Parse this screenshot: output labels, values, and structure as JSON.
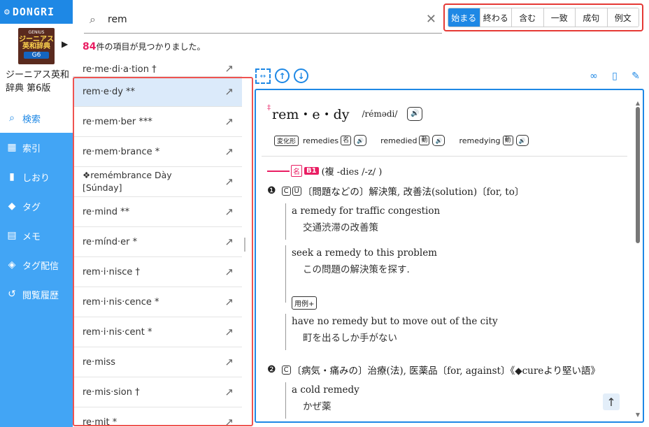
{
  "app": {
    "brand": "DONGRI"
  },
  "book": {
    "cover_top": "GENIUS",
    "cover_title": "ジーニアス英和辞典",
    "cover_edition": "G6",
    "title": "ジーニアス英和辞典 第6版"
  },
  "nav": [
    {
      "label": "検索",
      "icon": "search-icon"
    },
    {
      "label": "索引",
      "icon": "grid-icon"
    },
    {
      "label": "しおり",
      "icon": "bookmark-icon"
    },
    {
      "label": "タグ",
      "icon": "tag-icon"
    },
    {
      "label": "メモ",
      "icon": "memo-icon"
    },
    {
      "label": "タグ配信",
      "icon": "tag-share-icon"
    },
    {
      "label": "閲覧履歴",
      "icon": "history-icon"
    }
  ],
  "search": {
    "query": "rem"
  },
  "modes": [
    "始まる",
    "終わる",
    "含む",
    "一致",
    "成句",
    "例文"
  ],
  "result": {
    "count": "84",
    "suffix": "件の項目が見つかりました。"
  },
  "results": [
    "re·me·di·a·tion †",
    "rem·e·dy **",
    "re·mem·ber ***",
    "re·mem·brance *",
    "❖remémbrance Dày [Súnday]",
    "re·mind **",
    "re·mínd·er *",
    "rem·i·nisce †",
    "rem·i·nis·cence *",
    "rem·i·nis·cent *",
    "re·miss",
    "re·mis·sion †",
    "re·mit *"
  ],
  "entry": {
    "dagger": "‡",
    "headword": "rem・e・dy",
    "pron": "/rémədi/",
    "forms_label": "変化形",
    "forms": [
      {
        "word": "remedies",
        "tag": "名"
      },
      {
        "word": "remedied",
        "tag": "動"
      },
      {
        "word": "remedying",
        "tag": "動"
      }
    ],
    "pos": "名",
    "level": "B1",
    "plural": "(複 -dies /-z/ )",
    "sense1": {
      "num": "❶",
      "c": "C",
      "u": "U",
      "def": "〔問題などの〕解決策, 改善法(solution)〔for, to〕"
    },
    "ex1": {
      "en": "a remedy for traffic congestion",
      "ja": "交通渋滞の改善策"
    },
    "ex2": {
      "en": "seek a remedy to this problem",
      "ja": "この問題の解決策を探す."
    },
    "reuse": "用例+",
    "ex3": {
      "en": "have no remedy but to move out of the city",
      "ja": "町を出るしか手がない"
    },
    "sense2": {
      "num": "❷",
      "c": "C",
      "def": "〔病気・痛みの〕治療(法), 医薬品〔for, against〕《◆cureより堅い語》"
    },
    "ex4": {
      "en": "a cold remedy",
      "ja": "かぜ薬"
    }
  }
}
